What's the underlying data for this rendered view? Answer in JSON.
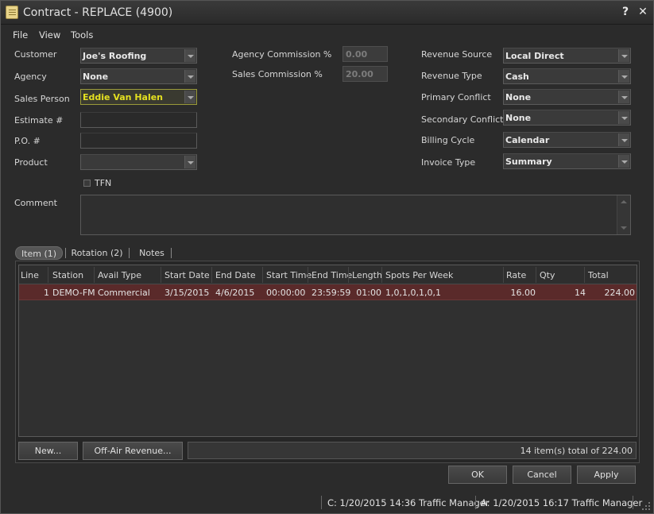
{
  "window": {
    "title": "Contract - REPLACE (4900)",
    "help_label": "?",
    "close_label": "✕"
  },
  "menu": [
    "File",
    "View",
    "Tools"
  ],
  "form": {
    "customer": {
      "label": "Customer",
      "value": "Joe's Roofing"
    },
    "agency": {
      "label": "Agency",
      "value": "None"
    },
    "sales_person": {
      "label": "Sales Person",
      "value": "Eddie Van Halen"
    },
    "estimate": {
      "label": "Estimate #",
      "value": ""
    },
    "po": {
      "label": "P.O. #",
      "value": ""
    },
    "product": {
      "label": "Product",
      "value": ""
    },
    "tfn": {
      "label": "TFN",
      "checked": false
    },
    "agency_commission": {
      "label": "Agency Commission %",
      "value": "0.00"
    },
    "sales_commission": {
      "label": "Sales Commission %",
      "value": "20.00"
    },
    "revenue_source": {
      "label": "Revenue Source",
      "value": "Local Direct"
    },
    "revenue_type": {
      "label": "Revenue Type",
      "value": "Cash"
    },
    "primary_conflict": {
      "label": "Primary Conflict",
      "value": "None"
    },
    "secondary_conflict": {
      "label": "Secondary Conflict",
      "value": "None"
    },
    "billing_cycle": {
      "label": "Billing Cycle",
      "value": "Calendar"
    },
    "invoice_type": {
      "label": "Invoice Type",
      "value": "Summary"
    },
    "comment": {
      "label": "Comment",
      "value": ""
    }
  },
  "tabs": [
    {
      "label": "Item (1)",
      "active": true
    },
    {
      "label": "Rotation (2)",
      "active": false
    },
    {
      "label": "Notes",
      "active": false
    }
  ],
  "grid": {
    "columns": [
      "Line",
      "Station",
      "Avail Type",
      "Start Date",
      "End Date",
      "Start Time",
      "End Time",
      "Length",
      "Spots Per Week",
      "Rate",
      "Qty",
      "Total"
    ],
    "rows": [
      [
        "1",
        "DEMO-FM",
        "Commercial",
        "3/15/2015",
        "4/6/2015",
        "00:00:00",
        "23:59:59",
        "01:00",
        "1,0,1,0,1,0,1",
        "16.00",
        "14",
        "224.00"
      ]
    ]
  },
  "buttons": {
    "new": "New...",
    "off_air": "Off-Air Revenue...",
    "ok": "OK",
    "cancel": "Cancel",
    "apply": "Apply"
  },
  "summary": "14 item(s) total of 224.00",
  "status": {
    "created": "C: 1/20/2015 14:36 Traffic Manager",
    "altered": "A: 1/20/2015 16:17 Traffic Manager"
  },
  "colors": {
    "selected_row": "#5a2a2a",
    "highlight_text": "#e4e020"
  }
}
